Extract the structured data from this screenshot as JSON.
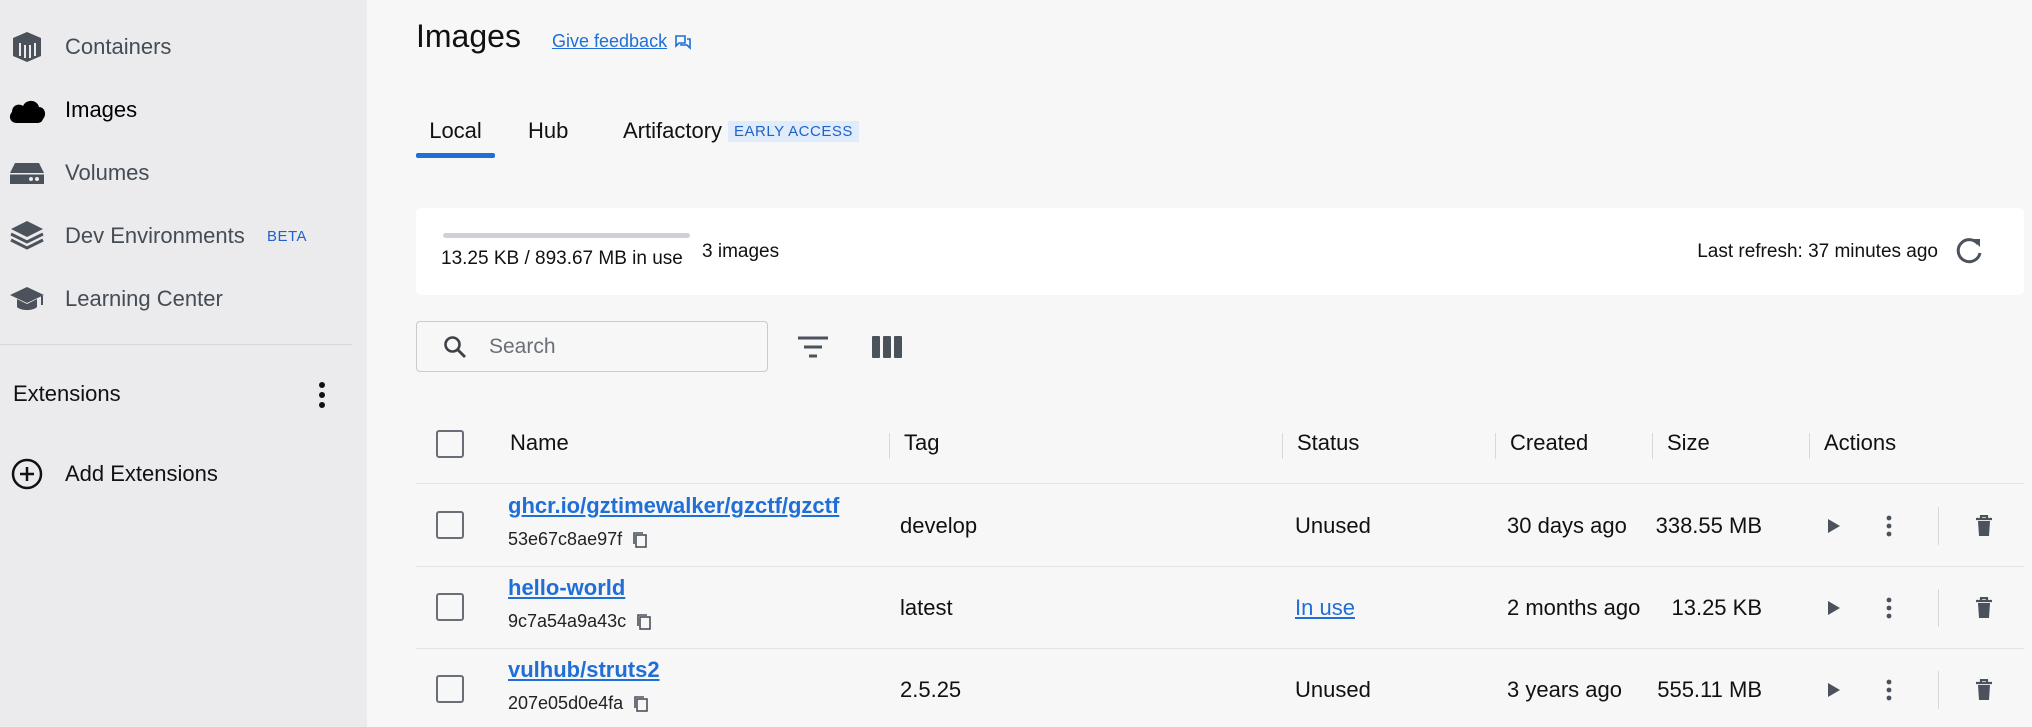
{
  "sidebar": {
    "items": [
      {
        "label": "Containers",
        "icon": "containers-icon"
      },
      {
        "label": "Images",
        "icon": "cloud-icon",
        "active": true
      },
      {
        "label": "Volumes",
        "icon": "volume-drive-icon"
      },
      {
        "label": "Dev Environments",
        "icon": "dev-environments-icon",
        "badge": "BETA"
      },
      {
        "label": "Learning Center",
        "icon": "graduation-cap-icon"
      }
    ],
    "extensions_title": "Extensions",
    "add_extensions_label": "Add Extensions"
  },
  "header": {
    "title": "Images",
    "feedback_label": "Give feedback"
  },
  "tabs": [
    {
      "label": "Local",
      "active": true
    },
    {
      "label": "Hub"
    },
    {
      "label": "Artifactory",
      "badge": "EARLY ACCESS"
    }
  ],
  "usage": {
    "text": "13.25 KB / 893.67 MB in use",
    "fraction": 1.45e-05,
    "count": "3 images",
    "last_refresh": "Last refresh: 37 minutes ago"
  },
  "search": {
    "placeholder": "Search",
    "value": ""
  },
  "table": {
    "columns": [
      "Name",
      "Tag",
      "Status",
      "Created",
      "Size",
      "Actions"
    ],
    "rows": [
      {
        "name": "ghcr.io/gztimewalker/gzctf/gzctf",
        "id": "53e67c8ae97f",
        "tag": "develop",
        "status": "Unused",
        "status_link": false,
        "created": "30 days ago",
        "size": "338.55 MB"
      },
      {
        "name": "hello-world",
        "id": "9c7a54a9a43c",
        "tag": "latest",
        "status": "In use",
        "status_link": true,
        "created": "2 months ago",
        "size": "13.25 KB"
      },
      {
        "name": "vulhub/struts2",
        "id": "207e05d0e4fa",
        "tag": "2.5.25",
        "status": "Unused",
        "status_link": false,
        "created": "3 years ago",
        "size": "555.11 MB"
      }
    ]
  },
  "colors": {
    "accent": "#1f6fd6",
    "sidebar_bg": "#ebebed",
    "page_bg": "#f7f7f7"
  }
}
